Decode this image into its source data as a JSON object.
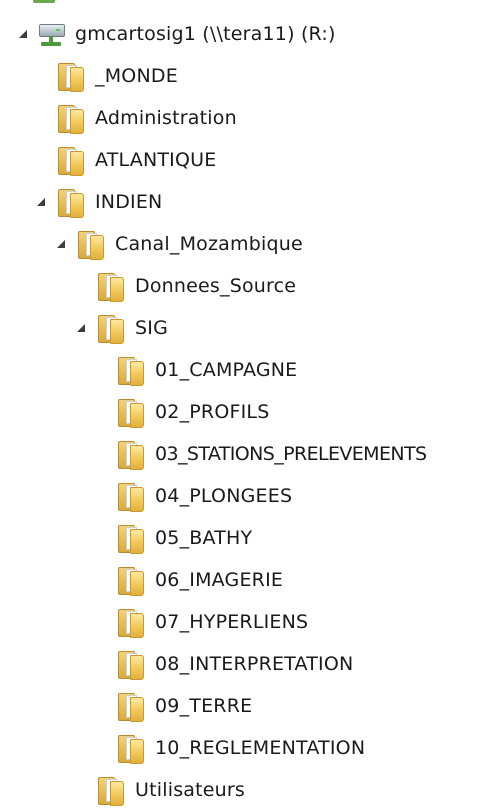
{
  "tree": {
    "nodes": [
      {
        "label": "gmcartosig1 (\\\\tera11) (R:)",
        "icon": "network-drive-icon",
        "state": "expanded"
      },
      {
        "label": "_MONDE",
        "icon": "folder-icon",
        "state": "collapsed"
      },
      {
        "label": "Administration",
        "icon": "folder-icon",
        "state": "collapsed"
      },
      {
        "label": "ATLANTIQUE",
        "icon": "folder-icon",
        "state": "collapsed"
      },
      {
        "label": "INDIEN",
        "icon": "folder-icon",
        "state": "expanded"
      },
      {
        "label": "Canal_Mozambique",
        "icon": "folder-icon",
        "state": "expanded"
      },
      {
        "label": "Donnees_Source",
        "icon": "folder-icon",
        "state": "collapsed"
      },
      {
        "label": "SIG",
        "icon": "folder-icon",
        "state": "expanded"
      },
      {
        "label": "01_CAMPAGNE",
        "icon": "folder-icon",
        "state": "collapsed"
      },
      {
        "label": "02_PROFILS",
        "icon": "folder-icon",
        "state": "collapsed"
      },
      {
        "label": "03_STATIONS_PRELEVEMENTS",
        "icon": "folder-icon",
        "state": "collapsed"
      },
      {
        "label": "04_PLONGEES",
        "icon": "folder-icon",
        "state": "collapsed"
      },
      {
        "label": "05_BATHY",
        "icon": "folder-icon",
        "state": "collapsed"
      },
      {
        "label": "06_IMAGERIE",
        "icon": "folder-icon",
        "state": "collapsed"
      },
      {
        "label": "07_HYPERLIENS",
        "icon": "folder-icon",
        "state": "collapsed"
      },
      {
        "label": "08_INTERPRETATION",
        "icon": "folder-icon",
        "state": "collapsed"
      },
      {
        "label": "09_TERRE",
        "icon": "folder-icon",
        "state": "collapsed"
      },
      {
        "label": "10_REGLEMENTATION",
        "icon": "folder-icon",
        "state": "collapsed"
      },
      {
        "label": "Utilisateurs",
        "icon": "folder-icon",
        "state": "collapsed"
      }
    ]
  }
}
